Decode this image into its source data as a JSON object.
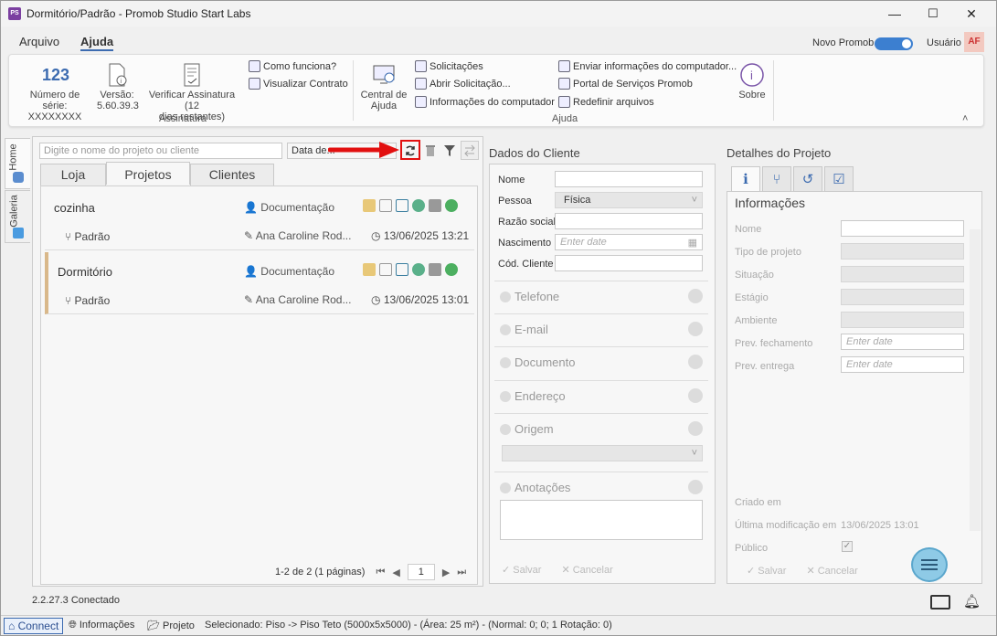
{
  "window": {
    "title": "Dormitório/Padrão - Promob Studio Start Labs",
    "app_icon": "PS",
    "minimize": "—",
    "maximize": "☐",
    "close": "✕"
  },
  "menu": {
    "items": [
      "Arquivo",
      "Ajuda"
    ],
    "active": "Ajuda",
    "novo_promob": "Novo Promob",
    "usuario": "Usuário",
    "avatar": "AF"
  },
  "ribbon": {
    "serial_label": "Número de série:",
    "serial_value": "XXXXXXXX",
    "serial_icon_text": "123",
    "version_label": "Versão:",
    "version_value": "5.60.39.3",
    "signature_label": "Verificar Assinatura (12 dias restantes)",
    "signature_line1": "Verificar Assinatura (12",
    "signature_line2": "dias restantes)",
    "como_funciona": "Como funciona?",
    "visualizar_contrato": "Visualizar Contrato",
    "group_assinatura": "Assinatura",
    "central_line1": "Central de",
    "central_line2": "Ajuda",
    "solicitacoes": "Solicitações",
    "abrir_solicitacao": "Abrir Solicitação...",
    "info_computador": "Informações do computador",
    "enviar_info": "Enviar informações do computador...",
    "portal": "Portal de Serviços Promob",
    "redefinir": "Redefinir arquivos",
    "sobre": "Sobre",
    "group_ajuda": "Ajuda",
    "collapse": "˄"
  },
  "sidebar": {
    "home": "Home",
    "galeria": "Galeria"
  },
  "projects": {
    "search_placeholder": "Digite o nome do projeto ou cliente",
    "sort_label": "Data de...",
    "tabs": [
      "Loja",
      "Projetos",
      "Clientes"
    ],
    "selected_tab": "Projetos",
    "items": [
      {
        "name": "cozinha",
        "doc": "Documentação",
        "sub": "Padrão",
        "author": "Ana Caroline Rod...",
        "date": "13/06/2025 13:21"
      },
      {
        "name": "Dormitório",
        "doc": "Documentação",
        "sub": "Padrão",
        "author": "Ana Caroline Rod...",
        "date": "13/06/2025 13:01"
      }
    ],
    "pager_text": "1-2 de 2 (1 páginas)",
    "page": "1"
  },
  "client": {
    "title": "Dados do Cliente",
    "nome": "Nome",
    "pessoa": "Pessoa",
    "pessoa_value": "Física",
    "razao": "Razão social",
    "nascimento": "Nascimento",
    "enter_date": "Enter date",
    "cod": "Cód. Cliente",
    "sections": [
      "Telefone",
      "E-mail",
      "Documento",
      "Endereço",
      "Origem",
      "Anotações"
    ],
    "salvar": "✓ Salvar",
    "cancelar": "✕ Cancelar"
  },
  "details": {
    "title": "Detalhes do Projeto",
    "info_title": "Informações",
    "fields": [
      "Nome",
      "Tipo de projeto",
      "Situação",
      "Estágio",
      "Ambiente",
      "Prev. fechamento",
      "Prev. entrega"
    ],
    "enter_date": "Enter date",
    "criado": "Criado em",
    "ultima": "Última modificação em",
    "ultima_value": "13/06/2025 13:01",
    "publico": "Público",
    "salvar": "✓ Salvar",
    "cancelar": "✕ Cancelar"
  },
  "footer": {
    "version": "2.2.27.3",
    "conectado": "Conectado"
  },
  "status": {
    "connect": "Connect",
    "informacoes": "Informações",
    "projeto": "Projeto",
    "selecionado": "Selecionado: Piso -> Piso Teto (5000x5x5000) - (Área: 25 m²) - (Normal: 0; 0; 1 Rotação: 0)"
  },
  "colors": {
    "accent": "#3c6bb0",
    "arrow": "#e21010",
    "selected_border": "#d9b88a"
  }
}
